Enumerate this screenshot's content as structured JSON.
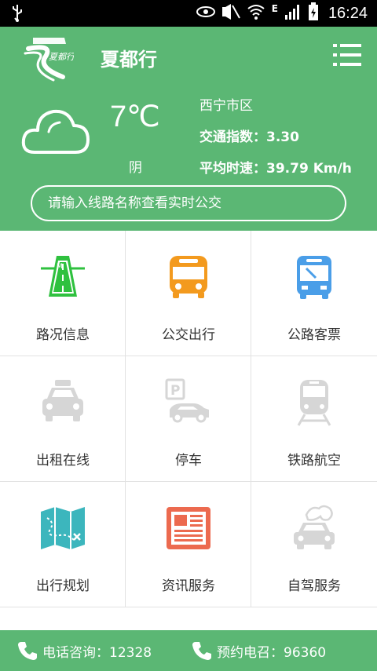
{
  "status_bar": {
    "time": "16:24",
    "network": "E"
  },
  "header": {
    "app_title": "夏都行",
    "logo_text": "夏都行"
  },
  "weather": {
    "temperature": "7℃",
    "condition": "阴",
    "district": "西宁市区",
    "traffic_index": "交通指数：3.30",
    "avg_speed": "平均时速：39.79 Km/h"
  },
  "search": {
    "placeholder": "请输入线路名称查看实时公交"
  },
  "grid": [
    {
      "label": "路况信息",
      "icon": "road-icon",
      "color": "#2fc13f"
    },
    {
      "label": "公交出行",
      "icon": "bus-icon",
      "color": "#f39a1e"
    },
    {
      "label": "公路客票",
      "icon": "coach-icon",
      "color": "#4a9ee8"
    },
    {
      "label": "出租在线",
      "icon": "taxi-icon",
      "color": "#d6d6d6"
    },
    {
      "label": "停车",
      "icon": "parking-icon",
      "color": "#d6d6d6"
    },
    {
      "label": "铁路航空",
      "icon": "train-icon",
      "color": "#d6d6d6"
    },
    {
      "label": "出行规划",
      "icon": "map-icon",
      "color": "#3cb6bd"
    },
    {
      "label": "资讯服务",
      "icon": "news-icon",
      "color": "#ec6a4f"
    },
    {
      "label": "自驾服务",
      "icon": "self-drive-icon",
      "color": "#d6d6d6"
    }
  ],
  "footer": {
    "consult": "电话咨询：12328",
    "booking": "预约电召：96360"
  }
}
